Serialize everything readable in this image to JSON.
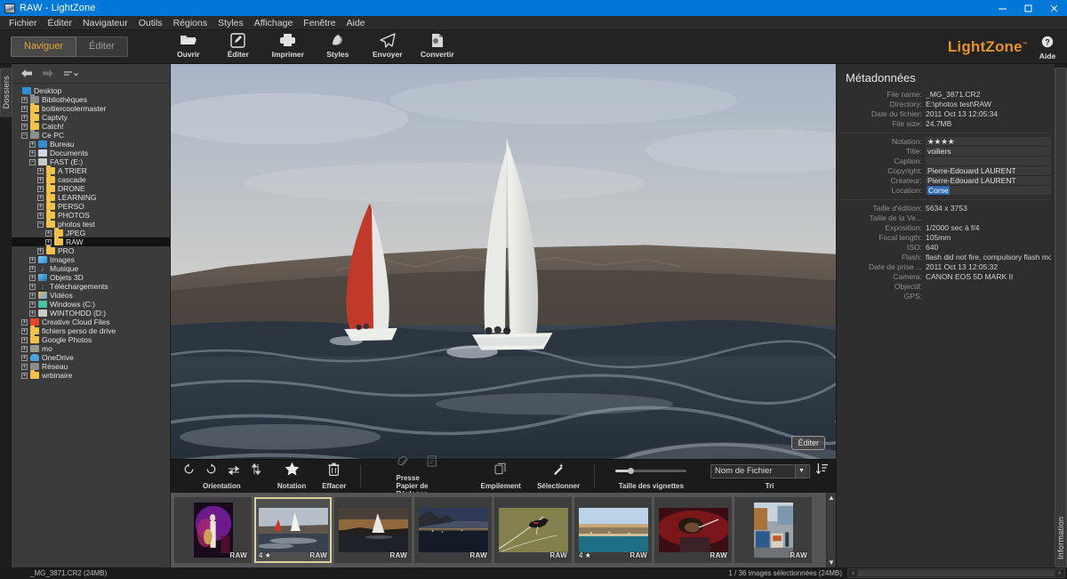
{
  "window": {
    "title": "RAW - LightZone",
    "controls": {
      "minimize": "minimize-icon",
      "maximize": "maximize-icon",
      "close": "close-icon"
    }
  },
  "menubar": {
    "items": [
      "Fichier",
      "Éditer",
      "Navigateur",
      "Outils",
      "Régions",
      "Styles",
      "Affichage",
      "Fenêtre",
      "Aide"
    ]
  },
  "toolbar": {
    "mode_browse": "Naviguer",
    "mode_edit": "Éditer",
    "actions": [
      {
        "label": "Ouvrir",
        "icon": "folder-open-icon"
      },
      {
        "label": "Éditer",
        "icon": "pencil-square-icon"
      },
      {
        "label": "Imprimer",
        "icon": "printer-icon"
      },
      {
        "label": "Styles",
        "icon": "styles-icon"
      },
      {
        "label": "Envoyer",
        "icon": "send-paperplane-icon"
      },
      {
        "label": "Convertir",
        "icon": "convert-document-icon"
      }
    ],
    "brand": "LightZone",
    "brand_mark": "™",
    "help_label": "Aide"
  },
  "left_tab": {
    "label": "Dossiers"
  },
  "folder_nav": {
    "back": "back-arrow-icon",
    "forward": "forward-arrow-icon",
    "sort": "sort-menu-icon"
  },
  "folder_tree": [
    {
      "label": "Desktop",
      "indent": 0,
      "expander": "",
      "icon": "monitor",
      "selected": false
    },
    {
      "label": "Bibliothèques",
      "indent": 1,
      "expander": "+",
      "icon": "folder-dark",
      "selected": false
    },
    {
      "label": "boitiercoolermaster",
      "indent": 1,
      "expander": "+",
      "icon": "folder",
      "selected": false
    },
    {
      "label": "Captvty",
      "indent": 1,
      "expander": "+",
      "icon": "folder",
      "selected": false
    },
    {
      "label": "Catch!",
      "indent": 1,
      "expander": "+",
      "icon": "folder",
      "selected": false
    },
    {
      "label": "Ce PC",
      "indent": 1,
      "expander": "−",
      "icon": "folder-dark",
      "selected": false
    },
    {
      "label": "Bureau",
      "indent": 2,
      "expander": "+",
      "icon": "monitor",
      "selected": false
    },
    {
      "label": "Documents",
      "indent": 2,
      "expander": "+",
      "icon": "doc",
      "selected": false
    },
    {
      "label": "FAST (E:)",
      "indent": 2,
      "expander": "−",
      "icon": "drive",
      "selected": false
    },
    {
      "label": "A TRIER",
      "indent": 3,
      "expander": "+",
      "icon": "folder",
      "selected": false
    },
    {
      "label": "cascade",
      "indent": 3,
      "expander": "+",
      "icon": "folder",
      "selected": false
    },
    {
      "label": "DRONE",
      "indent": 3,
      "expander": "+",
      "icon": "folder",
      "selected": false
    },
    {
      "label": "LEARNING",
      "indent": 3,
      "expander": "+",
      "icon": "folder",
      "selected": false
    },
    {
      "label": "PERSO",
      "indent": 3,
      "expander": "+",
      "icon": "folder",
      "selected": false
    },
    {
      "label": "PHOTOS",
      "indent": 3,
      "expander": "+",
      "icon": "folder",
      "selected": false
    },
    {
      "label": "photos test",
      "indent": 3,
      "expander": "−",
      "icon": "folder",
      "selected": false
    },
    {
      "label": "JPEG",
      "indent": 4,
      "expander": "+",
      "icon": "folder",
      "selected": false
    },
    {
      "label": "RAW",
      "indent": 4,
      "expander": "+",
      "icon": "folder",
      "selected": true
    },
    {
      "label": "PRO",
      "indent": 3,
      "expander": "+",
      "icon": "folder",
      "selected": false
    },
    {
      "label": "Images",
      "indent": 2,
      "expander": "+",
      "icon": "pic",
      "selected": false
    },
    {
      "label": "Musique",
      "indent": 2,
      "expander": "+",
      "icon": "music",
      "selected": false
    },
    {
      "label": "Objets 3D",
      "indent": 2,
      "expander": "+",
      "icon": "d3",
      "selected": false
    },
    {
      "label": "Téléchargements",
      "indent": 2,
      "expander": "+",
      "icon": "dl",
      "selected": false
    },
    {
      "label": "Vidéos",
      "indent": 2,
      "expander": "+",
      "icon": "vid",
      "selected": false
    },
    {
      "label": "Windows (C:)",
      "indent": 2,
      "expander": "+",
      "icon": "win",
      "selected": false
    },
    {
      "label": "WINTOHDD (D:)",
      "indent": 2,
      "expander": "+",
      "icon": "drive",
      "selected": false
    },
    {
      "label": "Creative Cloud Files",
      "indent": 1,
      "expander": "+",
      "icon": "cc",
      "selected": false
    },
    {
      "label": "fichiers perso de drive",
      "indent": 1,
      "expander": "+",
      "icon": "folder",
      "selected": false
    },
    {
      "label": "Google Photos",
      "indent": 1,
      "expander": "+",
      "icon": "folder",
      "selected": false
    },
    {
      "label": "mo",
      "indent": 1,
      "expander": "+",
      "icon": "mo",
      "selected": false
    },
    {
      "label": "OneDrive",
      "indent": 1,
      "expander": "+",
      "icon": "onedrive",
      "selected": false
    },
    {
      "label": "Réseau",
      "indent": 1,
      "expander": "+",
      "icon": "net",
      "selected": false
    },
    {
      "label": "wrbinaire",
      "indent": 1,
      "expander": "+",
      "icon": "folder",
      "selected": false
    }
  ],
  "viewer": {
    "edit_overlay_label": "Éditer",
    "image_description": "Two sailing yachts racing on rough dark sea with cliffs behind"
  },
  "bottom_toolbar": {
    "groups": [
      {
        "label": "Orientation",
        "icons": [
          "rotate-left-icon",
          "rotate-right-icon",
          "flip-horizontal-icon",
          "flip-vertical-icon"
        ]
      },
      {
        "label": "Notation",
        "icons": [
          "star-icon"
        ]
      },
      {
        "label": "Effacer",
        "icons": [
          "trash-icon"
        ]
      },
      {
        "label": "Presse Papier de Réglages",
        "icons": [
          "copy-settings-icon",
          "paste-settings-icon"
        ]
      },
      {
        "label": "Empilement",
        "icons": [
          "stack-icon"
        ]
      },
      {
        "label": "Sélectionner",
        "icons": [
          "magic-wand-icon"
        ]
      },
      {
        "label": "Taille des vignettes",
        "icons": [
          "thumbnail-size-slider"
        ]
      },
      {
        "label": "Tri",
        "icons": [
          "sort-direction-icon"
        ]
      }
    ],
    "sort_value": "Nom de Fichier"
  },
  "thumbnails": [
    {
      "id": 1,
      "tag": "RAW",
      "rating": "",
      "selected": false,
      "alt": "concert performer in purple light"
    },
    {
      "id": 2,
      "tag": "RAW",
      "rating": "4",
      "selected": true,
      "alt": "sailboats at sea"
    },
    {
      "id": 3,
      "tag": "RAW",
      "rating": "",
      "selected": false,
      "alt": "sailboat at sunset"
    },
    {
      "id": 4,
      "tag": "RAW",
      "rating": "",
      "selected": false,
      "alt": "coastal bay at dusk"
    },
    {
      "id": 5,
      "tag": "RAW",
      "rating": "",
      "selected": false,
      "alt": "red-winged blackbird on reed"
    },
    {
      "id": 6,
      "tag": "RAW",
      "rating": "4",
      "selected": false,
      "alt": "coastal town panorama"
    },
    {
      "id": 7,
      "tag": "RAW",
      "rating": "",
      "selected": false,
      "alt": "singer with curly hair on red stage"
    },
    {
      "id": 8,
      "tag": "RAW",
      "rating": "",
      "selected": false,
      "alt": "street market stall"
    }
  ],
  "metadata": {
    "title": "Métadonnées",
    "file_info": [
      {
        "key": "File name:",
        "value": "_MG_3871.CR2"
      },
      {
        "key": "Directory:",
        "value": "E:\\photos test\\RAW"
      },
      {
        "key": "Date du fichier:",
        "value": "2011 Oct 13 12:05:34"
      },
      {
        "key": "File size:",
        "value": "24.7MB"
      }
    ],
    "editable_fields": [
      {
        "key": "Notation:",
        "value": "★★★★",
        "selected": false
      },
      {
        "key": "Title:",
        "value": "voiliers",
        "selected": false
      },
      {
        "key": "Caption:",
        "value": "",
        "selected": false
      },
      {
        "key": "Copyright:",
        "value": "Pierre-Edouard LAURENT",
        "selected": false
      },
      {
        "key": "Créateur:",
        "value": "Pierre-Edouard LAURENT",
        "selected": false
      },
      {
        "key": "Location:",
        "value": "Corse",
        "selected": true
      }
    ],
    "exif": [
      {
        "key": "Taille d'édition:",
        "value": "5634 x 3753"
      },
      {
        "key": "Taille de la Ve...",
        "value": ""
      },
      {
        "key": "Exposition:",
        "value": "1/2000 sec à f/4"
      },
      {
        "key": "Focal length:",
        "value": "105mm"
      },
      {
        "key": "ISO:",
        "value": "640"
      },
      {
        "key": "Flash:",
        "value": "flash did not fire, compulsory flash mode"
      },
      {
        "key": "Date de prise ...",
        "value": "2011 Oct 13 12:05:32"
      },
      {
        "key": "Camera:",
        "value": "CANON EOS 5D MARK II"
      },
      {
        "key": "Objectif:",
        "value": ""
      },
      {
        "key": "GPS:",
        "value": ""
      }
    ]
  },
  "right_tab": {
    "label": "Information"
  },
  "statusbar": {
    "left": "_MG_3871.CR2 (24MB)",
    "right": "1 / 36 images sélectionnées (24MB)",
    "scroll_left_arrow": "‹",
    "scroll_right_arrow": "›"
  },
  "colors": {
    "accent": "#e8922a",
    "titlebar": "#0078d7",
    "panel_bg": "#2e2e2e",
    "tree_bg": "#3b3b3b",
    "viewer_bg": "#555555",
    "selection": "#2f6bb5",
    "thumb_selected_border": "#d8d0a0"
  }
}
